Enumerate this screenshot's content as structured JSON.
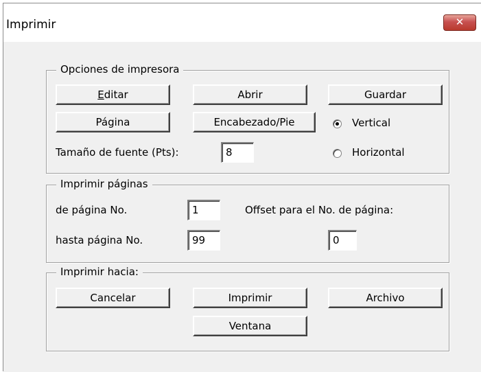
{
  "window": {
    "title": "Imprimir",
    "close_glyph": "✕"
  },
  "options": {
    "legend": "Opciones de impresora",
    "edit_button": "Editar",
    "open_button": "Abrir",
    "save_button": "Guardar",
    "page_button": "Página",
    "header_footer_button": "Encabezado/Pie",
    "vertical_label": "Vertical",
    "horizontal_label": "Horizontal",
    "orientation_selected": "Vertical",
    "font_size_label": "Tamaño de fuente (Pts):",
    "font_size_value": "8"
  },
  "pages": {
    "legend": "Imprimir páginas",
    "from_label": "de página No.",
    "from_value": "1",
    "to_label": "hasta página No.",
    "to_value": "99",
    "offset_label": "Offset para el No. de página:",
    "offset_value": "0"
  },
  "output": {
    "legend": "Imprimir hacia:",
    "cancel_button": "Cancelar",
    "print_button": "Imprimir",
    "file_button": "Archivo",
    "window_button": "Ventana"
  },
  "colors": {
    "close_button": "#c75050",
    "dialog_bg": "#f0f0f0"
  }
}
